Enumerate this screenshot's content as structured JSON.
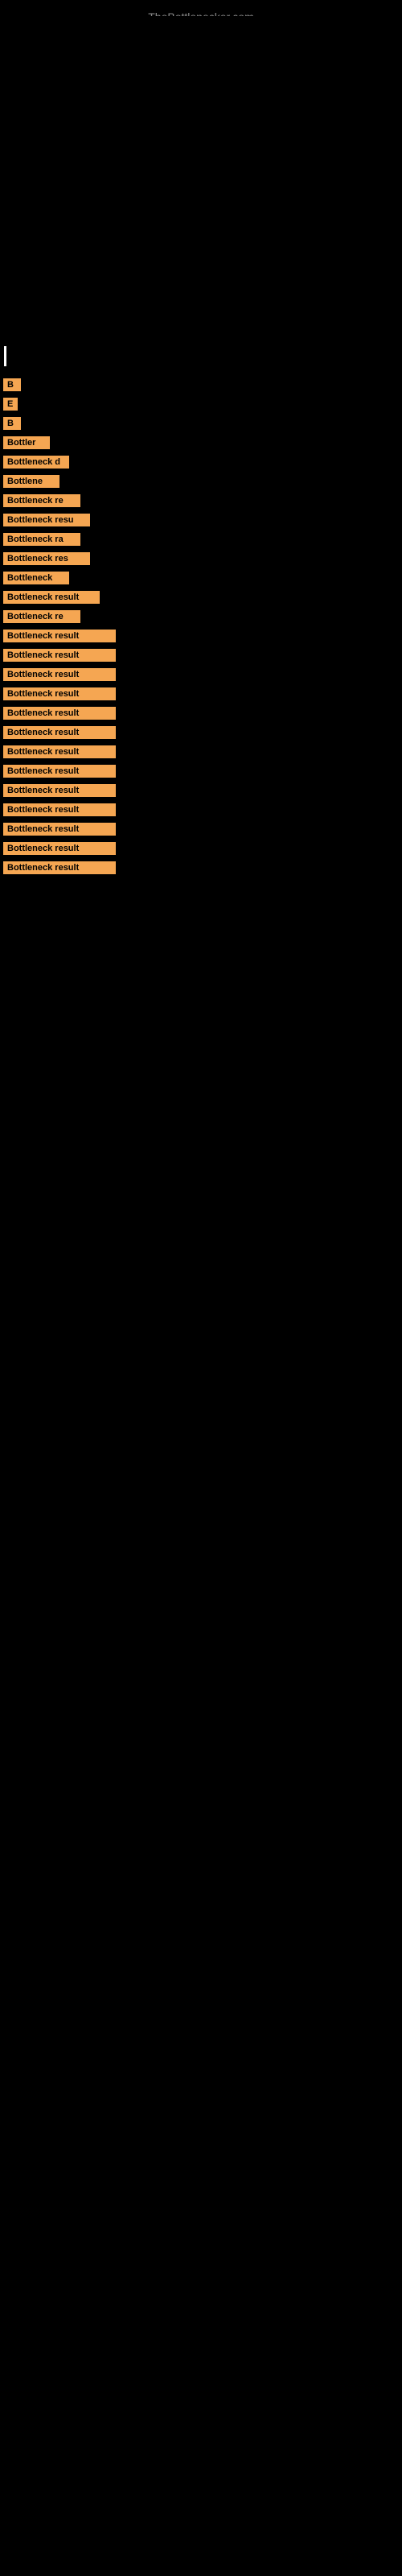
{
  "site": {
    "title": "TheBottlenecker.com"
  },
  "bottleneck_labels": [
    "B",
    "E",
    "B",
    "Bottler",
    "Bottleneck d",
    "Bottlene",
    "Bottleneck re",
    "Bottleneck resu",
    "Bottleneck ra",
    "Bottleneck res",
    "Bottleneck",
    "Bottleneck result",
    "Bottleneck re",
    "Bottleneck result",
    "Bottleneck result",
    "Bottleneck result",
    "Bottleneck result",
    "Bottleneck result",
    "Bottleneck result",
    "Bottleneck result",
    "Bottleneck result",
    "Bottleneck result",
    "Bottleneck result",
    "Bottleneck result",
    "Bottleneck result",
    "Bottleneck result"
  ],
  "accent_color": "#f5a652",
  "background_color": "#000000"
}
